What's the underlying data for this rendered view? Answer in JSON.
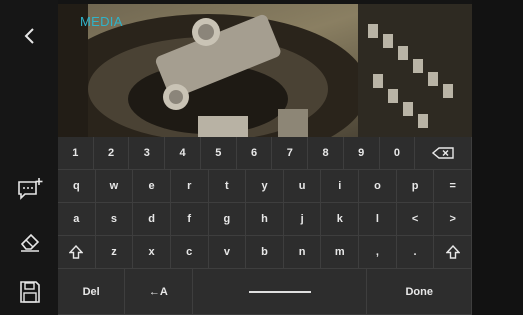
{
  "sidebar": {
    "back_icon": "chevron-left-icon",
    "tools": [
      {
        "name": "add-text-icon"
      },
      {
        "name": "eraser-icon"
      },
      {
        "name": "save-icon"
      }
    ]
  },
  "camera": {
    "label": "MEDIA",
    "label_color": "#2fb3c9"
  },
  "keyboard": {
    "row1": [
      "1",
      "2",
      "3",
      "4",
      "5",
      "6",
      "7",
      "8",
      "9",
      "0"
    ],
    "row2": [
      "q",
      "w",
      "e",
      "r",
      "t",
      "y",
      "u",
      "i",
      "o",
      "p",
      "="
    ],
    "row3": [
      "a",
      "s",
      "d",
      "f",
      "g",
      "h",
      "j",
      "k",
      "l",
      "<",
      ">"
    ],
    "row4": [
      "z",
      "x",
      "c",
      "v",
      "b",
      "n",
      "m",
      ",",
      "."
    ],
    "del_label": "Del",
    "back_label": "←A",
    "done_label": "Done"
  }
}
